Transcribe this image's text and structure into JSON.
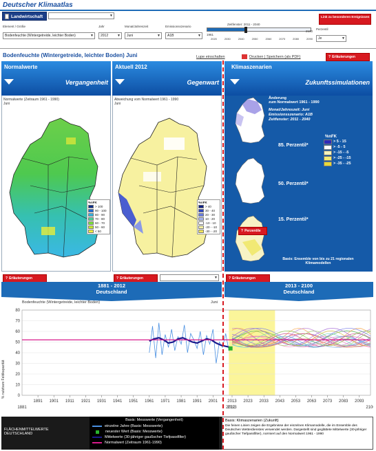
{
  "app": {
    "title": "Deutscher Klimaatlas"
  },
  "tabs": {
    "active_label": "Landwirtschaft"
  },
  "controls": {
    "element_label": "Element / Größe",
    "element_value": "Bodenfeuchte (Wintergetreide, leichter Boden)",
    "year_label": "Jahr",
    "year_value": "2012",
    "month_label": "Monat/Jahreszeit",
    "month_value": "Juni",
    "scenario_label": "Emissionsszenario",
    "scenario_value": "A1B",
    "period_label": "Zeitfenster: 2011 - 2040",
    "slider_ticks": [
      "2020",
      "2030",
      "2040",
      "2050",
      "2060",
      "2070",
      "2080",
      "2090"
    ],
    "slider_left_value": "1961",
    "slider_right_value": "2100",
    "ensemble_label": "Perzentil",
    "ensemble_value": "Je",
    "info_button": "Link zu besonderen Ereignissen"
  },
  "subheader": {
    "title": "Bodenfeuchte (Wintergetreide, leichter Boden) Juni",
    "link_legend": "Lupe einschalten",
    "link_print": "Drucken | Speichern (als PDF)",
    "explain_button": "Erläuterungen"
  },
  "panels": {
    "normal": {
      "title": "Normalwerte",
      "subtitle": "Vergangenheit",
      "desc": "Normalwerte (Zeitraum 1961 - 1990)",
      "month": "Juni",
      "legend_title": "%nFK",
      "legend": [
        {
          "color": "#0b2d8a",
          "label": "> 100"
        },
        {
          "color": "#1f6ed6",
          "label": "90 - 100"
        },
        {
          "color": "#35b4e0",
          "label": "80 - 90"
        },
        {
          "color": "#4fd29a",
          "label": "70 - 80"
        },
        {
          "color": "#7be33c",
          "label": "60 - 70"
        },
        {
          "color": "#c6ea2a",
          "label": "50 - 60"
        },
        {
          "color": "#f2ef3a",
          "label": "< 50"
        }
      ]
    },
    "current": {
      "title": "Aktuell 2012",
      "subtitle": "Gegenwart",
      "desc": "Abweichung vom Normalwert 1961 - 1990",
      "month": "Juni",
      "legend_title": "%nFK",
      "legend": [
        {
          "color": "#0d1f87",
          "label": "> 40"
        },
        {
          "color": "#2f46c4",
          "label": "30 - 40"
        },
        {
          "color": "#6a7ee3",
          "label": "20 - 30"
        },
        {
          "color": "#a9b6f1",
          "label": "10 - 20"
        },
        {
          "color": "#ffffff",
          "label": "-10 - 10"
        },
        {
          "color": "#f7f2a3",
          "label": "-20 - -10"
        },
        {
          "color": "#f0e35a",
          "label": "-30 - -20"
        }
      ]
    },
    "future": {
      "title": "Klimaszenarien",
      "subtitle": "Zukunftssimulationen",
      "change_title": "Änderung",
      "change_sub": "zum Normalwert 1961 - 1990",
      "month_line": "Monat/Jahreszeit: Juni",
      "scenario_line": "Emissionsszenario: A1B",
      "period_line": "Zeitfenster: 2011 - 2040",
      "legend_title": "%nFK",
      "legend": [
        {
          "color": "#2e2ab8",
          "label": ">  5  -  15"
        },
        {
          "color": "#ffffff",
          "label": ">  -5  -  5"
        },
        {
          "color": "#f4f2b8",
          "label": "> -15  -  -5"
        },
        {
          "color": "#f1e974",
          "label": "> -25  -  -15"
        },
        {
          "color": "#e7d83a",
          "label": "> -35  -  -25"
        }
      ],
      "perc_85": "85. Perzentil*",
      "perc_50": "50. Perzentil*",
      "perc_15": "15. Perzentil*",
      "perc_button": "Perzentile",
      "basis": "Basis: Ensemble von bis zu 21 regionalen Klimamodellen"
    }
  },
  "explain_labels": {
    "a": "Erläuterungen",
    "b": "Erläuterungen",
    "c": "Erläuterungen"
  },
  "banners": {
    "left_years": "1881 - 2012",
    "left_region": "Deutschland",
    "right_years": "2013 - 2100",
    "right_region": "Deutschland"
  },
  "chart_data": {
    "type": "line",
    "title": "Bodenfeuchte (Wintergetreide, leichter Boden)",
    "month_label": "Juni",
    "ylabel": "% nutzbare Feldkapazität",
    "ylim": [
      0,
      80
    ],
    "yticks": [
      0,
      10,
      20,
      30,
      40,
      50,
      60,
      70,
      80
    ],
    "xlim": [
      1881,
      2100
    ],
    "xticks_top": [
      "1891",
      "1901",
      "1911",
      "1921",
      "1931",
      "1941",
      "1951",
      "1961",
      "1971",
      "1981",
      "1991",
      "2001",
      "2013",
      "2023",
      "2033",
      "2043",
      "2053",
      "2063",
      "2073",
      "2083",
      "2093"
    ],
    "xticks_bottom": [
      "1881",
      "2012",
      "2013",
      "2100"
    ],
    "normal_value": 52,
    "split_year": 2012.5,
    "highlight_period": [
      2011,
      2040
    ],
    "series": [
      {
        "name": "einzelne Jahre (Basis: Messwerte)",
        "color": "#4a90e2",
        "x": [
          1961,
          1963,
          1965,
          1967,
          1969,
          1971,
          1973,
          1975,
          1977,
          1979,
          1981,
          1983,
          1985,
          1987,
          1989,
          1991,
          1993,
          1995,
          1997,
          1999,
          2001,
          2003,
          2005,
          2007,
          2009,
          2011,
          2012
        ],
        "values": [
          40,
          65,
          35,
          68,
          38,
          57,
          45,
          62,
          42,
          55,
          48,
          66,
          40,
          58,
          52,
          44,
          60,
          38,
          56,
          48,
          62,
          30,
          50,
          45,
          58,
          42,
          44
        ]
      },
      {
        "name": "Mittelwerte (30-jähriger gaußscher Tiefpassfilter)",
        "color": "#1a1a8c",
        "x": [
          1961,
          1964,
          1967,
          1970,
          1973,
          1976,
          1979,
          1982,
          1985,
          1988,
          1991,
          1994,
          1997,
          2000,
          2003,
          2006,
          2009,
          2012
        ],
        "values": [
          51,
          53,
          54,
          52,
          49,
          50,
          53,
          54,
          52,
          50,
          49,
          51,
          53,
          52,
          49,
          47,
          46,
          45
        ]
      }
    ],
    "newest_value": {
      "year": 2012,
      "value": 44
    },
    "future_lines": 20,
    "future_range": [
      40,
      64
    ]
  },
  "footer": {
    "left_title_1": "FLÄCHENMITTELWERTE",
    "left_title_2": "DEUTSCHLAND",
    "past_head": "Basis: Messwerte (Vergangenheit)",
    "past_items": [
      {
        "label": "einzelne Jahre (Basis: Messwerte)",
        "color": "#4a90e2"
      },
      {
        "label": "neuester Wert (Basis: Messwerte)",
        "color": "#29b32e"
      },
      {
        "label": "Mittelwerte (30-jähriger gaußscher Tiefpassfilter)",
        "color": "#1a1a8c"
      },
      {
        "label": "Normalwert (Zeitraum 1961-1990)",
        "color": "#d81b8c"
      }
    ],
    "future_head": "Basis: Klimaszenarien (Zukunft)",
    "future_text": "Die feinen Linien zeigen die Ergebnisse der einzelnen Klimamodelle, die im Ensemble des Deutschen Wetterdienstes verwendet werden. Dargestellt sind geglättete Mittelwerte (30-jähriger gaußscher Tiefpassfilter), normiert auf den Normalwert 1961 - 1990"
  }
}
